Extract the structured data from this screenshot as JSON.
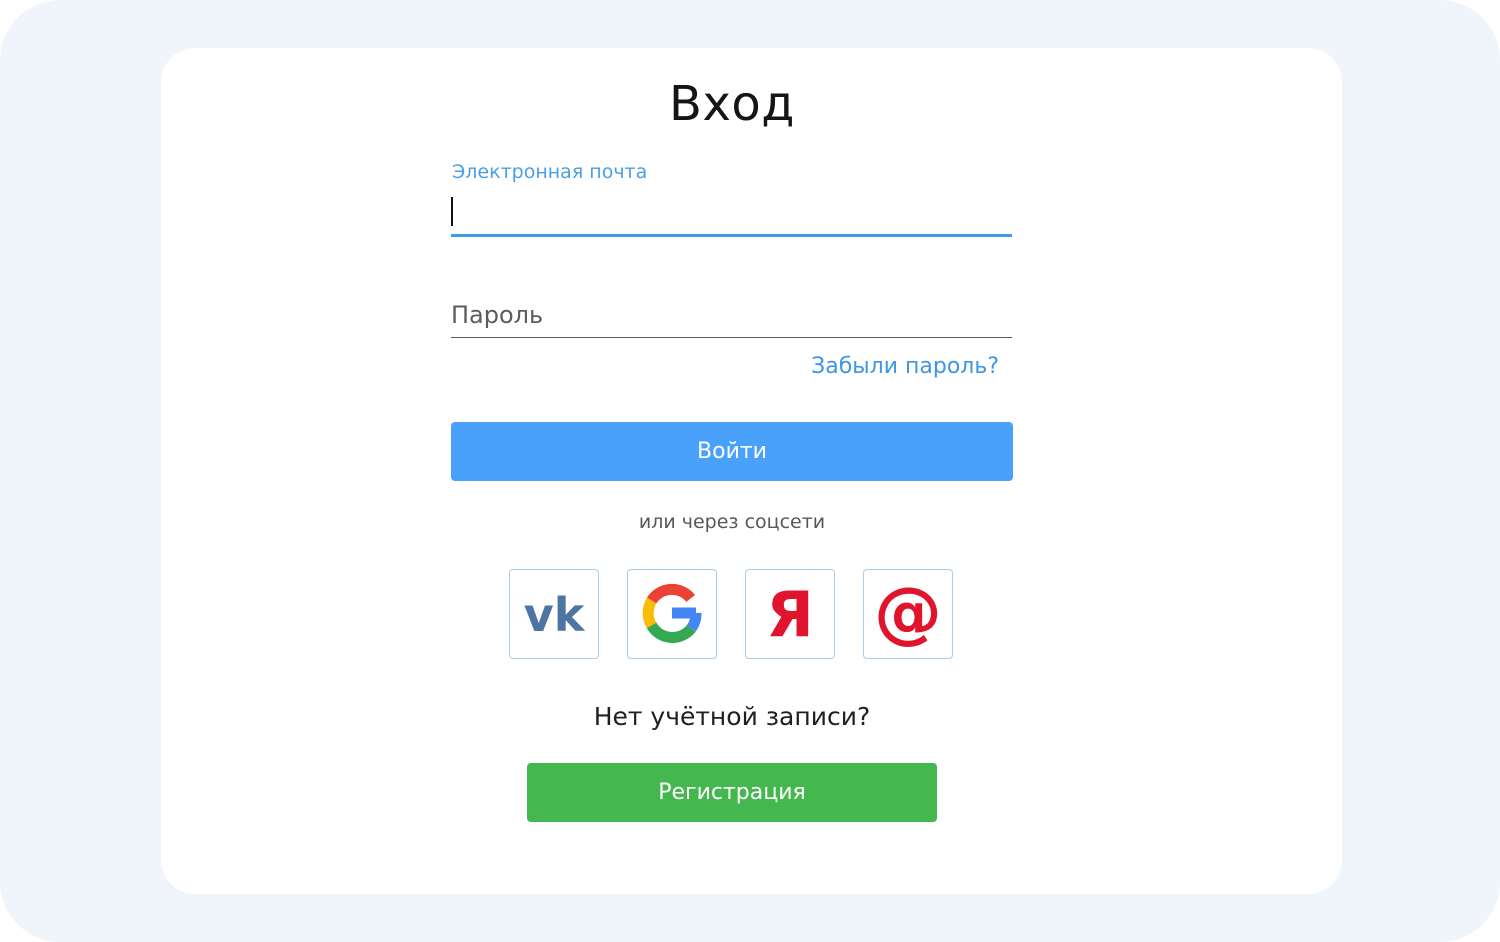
{
  "login_form": {
    "title": "Вход",
    "email": {
      "label": "Электронная почта",
      "value": ""
    },
    "password": {
      "placeholder": "Пароль",
      "value": ""
    },
    "forgot_password_link": "Забыли пароль?",
    "login_button": "Войти",
    "social_caption": "или через соцсети",
    "social_providers": [
      {
        "name": "vk",
        "icon": "vk-icon",
        "color": "#4c75a3"
      },
      {
        "name": "google",
        "icon": "google-icon",
        "colors": [
          "#ea4335",
          "#fbbc05",
          "#34a853",
          "#4285f4"
        ]
      },
      {
        "name": "yandex",
        "icon": "yandex-icon",
        "glyph": "Я",
        "color": "#e0152d"
      },
      {
        "name": "mailru",
        "icon": "mailru-icon",
        "glyph": "@",
        "color": "#e0152d"
      }
    ],
    "no_account_text": "Нет учётной записи?",
    "register_button": "Регистрация"
  },
  "colors": {
    "background": "#eff5fb",
    "card": "#ffffff",
    "accent_blue": "#49a1fb",
    "link_blue": "#3e96e4",
    "register_green": "#44b84e"
  }
}
